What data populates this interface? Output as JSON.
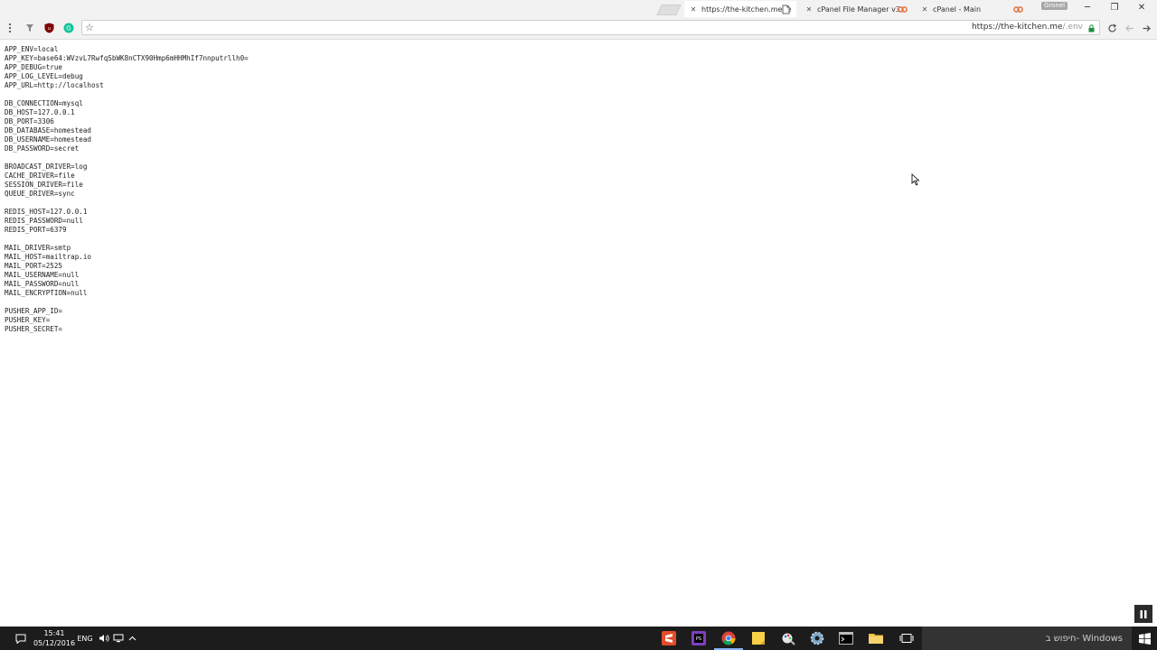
{
  "browser": {
    "tabs": [
      {
        "title": "https://the-kitchen.me/.e",
        "active": true
      },
      {
        "title": "cPanel File Manager v3",
        "active": false
      },
      {
        "title": "cPanel - Main",
        "active": false
      }
    ],
    "profile_label": "Gronel",
    "url": {
      "host": "https://the-kitchen.me",
      "path": "/.env"
    }
  },
  "env_groups": [
    [
      "APP_ENV=local",
      "APP_KEY=base64:WVzvL7RwfqSbWK8nCTX90Hmp6mHHMhIf7nnputrllh0=",
      "APP_DEBUG=true",
      "APP_LOG_LEVEL=debug",
      "APP_URL=http://localhost"
    ],
    [
      "DB_CONNECTION=mysql",
      "DB_HOST=127.0.0.1",
      "DB_PORT=3306",
      "DB_DATABASE=homestead",
      "DB_USERNAME=homestead",
      "DB_PASSWORD=secret"
    ],
    [
      "BROADCAST_DRIVER=log",
      "CACHE_DRIVER=file",
      "SESSION_DRIVER=file",
      "QUEUE_DRIVER=sync"
    ],
    [
      "REDIS_HOST=127.0.0.1",
      "REDIS_PASSWORD=null",
      "REDIS_PORT=6379"
    ],
    [
      "MAIL_DRIVER=smtp",
      "MAIL_HOST=mailtrap.io",
      "MAIL_PORT=2525",
      "MAIL_USERNAME=null",
      "MAIL_PASSWORD=null",
      "MAIL_ENCRYPTION=null"
    ],
    [
      "PUSHER_APP_ID=",
      "PUSHER_KEY=",
      "PUSHER_SECRET="
    ]
  ],
  "taskbar": {
    "clock_time": "15:41",
    "clock_date": "05/12/2016",
    "language": "ENG",
    "search_placeholder": "חיפוש ב- Windows"
  },
  "colors": {
    "chrome_bg": "#f2f2f2",
    "taskbar_bg": "#1c1c1c",
    "link_icon": "#e8774a"
  }
}
